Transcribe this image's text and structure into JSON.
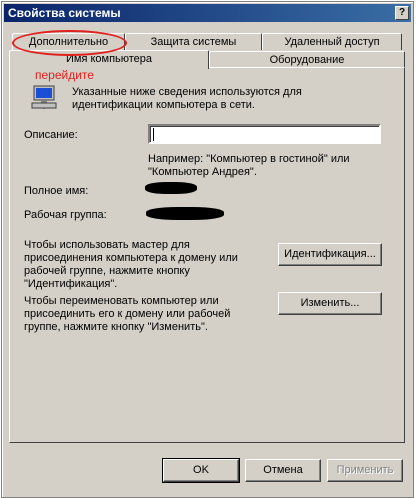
{
  "window": {
    "title": "Свойства системы",
    "help_label": "?"
  },
  "tabs_row1": [
    {
      "label": "Дополнительно"
    },
    {
      "label": "Защита системы"
    },
    {
      "label": "Удаленный доступ"
    }
  ],
  "tabs_row2": [
    {
      "label": "Имя компьютера"
    },
    {
      "label": "Оборудование"
    }
  ],
  "annotation": {
    "text": "перейдите",
    "color": "#e0201c"
  },
  "computer_name_tab": {
    "intro_line1": "Указанные ниже сведения используются для",
    "intro_line2": "идентификации компьютера в сети.",
    "description_label": "Описание:",
    "description_value": "",
    "example_line1": "Например: \"Компьютер в гостиной\" или",
    "example_line2": "\"Компьютер Андрея\".",
    "full_name_label": "Полное имя:",
    "workgroup_label": "Рабочая группа:",
    "wizard_line1": "Чтобы использовать мастер для",
    "wizard_line2": "присоединения компьютера к домену или",
    "wizard_line3": "рабочей группе, нажмите кнопку",
    "wizard_line4": "\"Идентификация\".",
    "identify_button": "Идентификация...",
    "rename_line1": "Чтобы переименовать компьютер или",
    "rename_line2": "присоединить его к домену или рабочей",
    "rename_line3": "группе, нажмите кнопку \"Изменить\".",
    "change_button": "Изменить..."
  },
  "footer": {
    "ok_label": "OK",
    "cancel_label": "Отмена",
    "apply_label": "Применить"
  }
}
